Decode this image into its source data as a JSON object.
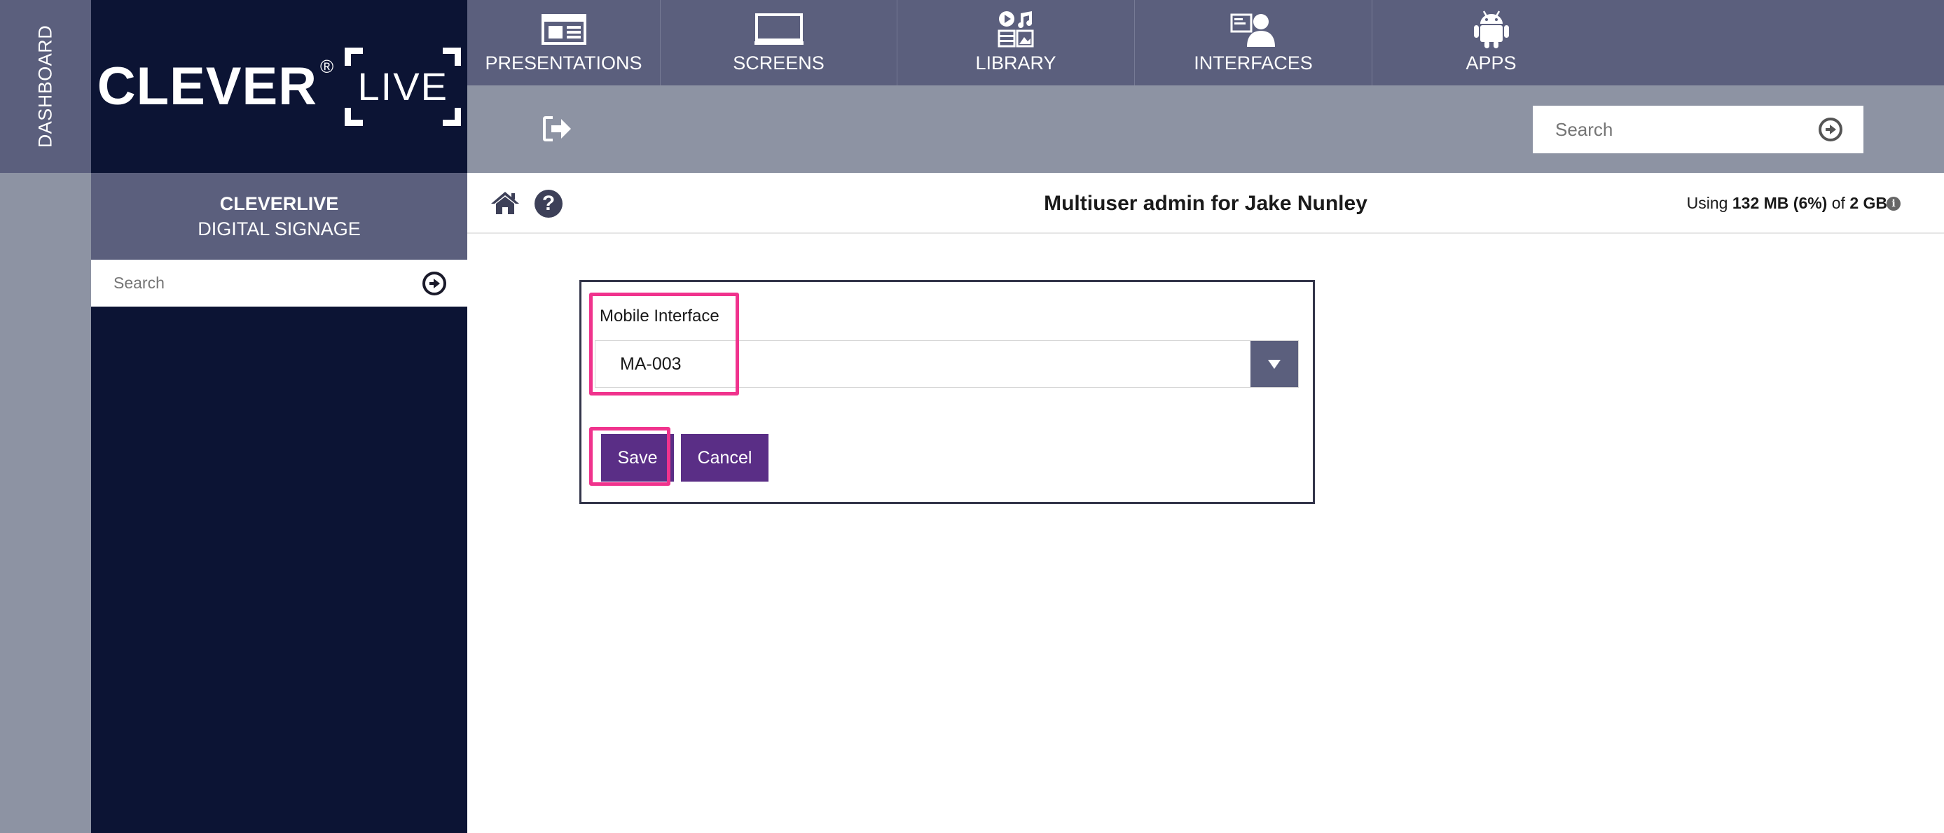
{
  "dashboard": {
    "label": "DASHBOARD"
  },
  "logo": {
    "brand": "CLEVER",
    "reg_mark": "®",
    "product": "LIVE"
  },
  "organization": {
    "name": "CLEVERLIVE",
    "subtitle": "DIGITAL SIGNAGE"
  },
  "sidebar_search": {
    "placeholder": "Search"
  },
  "nav": {
    "items": [
      {
        "label": "PRESENTATIONS",
        "icon": "presentation-icon"
      },
      {
        "label": "SCREENS",
        "icon": "monitor-icon"
      },
      {
        "label": "LIBRARY",
        "icon": "media-library-icon"
      },
      {
        "label": "INTERFACES",
        "icon": "interfaces-icon"
      },
      {
        "label": "APPS",
        "icon": "android-icon"
      }
    ]
  },
  "toolbar": {
    "logout_icon": "logout-icon",
    "search_placeholder": "Search"
  },
  "header": {
    "title": "Multiuser admin for Jake Nunley",
    "usage_prefix": "Using ",
    "usage_amount": "132 MB (6%)",
    "usage_middle": " of ",
    "usage_total": "2 GB"
  },
  "form": {
    "field_label": "Mobile Interface",
    "selected_value": "MA-003",
    "save_label": "Save",
    "cancel_label": "Cancel"
  },
  "colors": {
    "nav_bg": "#5b5f7d",
    "toolbar_bg": "#8d93a3",
    "sidebar_bg": "#0c1434",
    "button_bg": "#5a2e86",
    "highlight": "#f0338d"
  }
}
